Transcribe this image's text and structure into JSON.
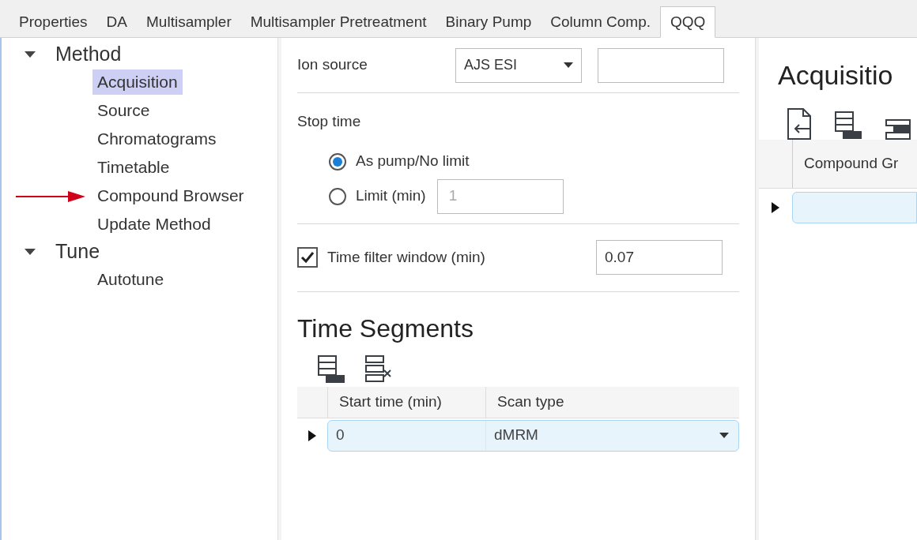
{
  "tabs": [
    {
      "label": "Properties",
      "selected": false
    },
    {
      "label": "DA",
      "selected": false
    },
    {
      "label": "Multisampler",
      "selected": false
    },
    {
      "label": "Multisampler Pretreatment",
      "selected": false
    },
    {
      "label": "Binary Pump",
      "selected": false
    },
    {
      "label": "Column Comp.",
      "selected": false
    },
    {
      "label": "QQQ",
      "selected": true
    }
  ],
  "tree": [
    {
      "label": "Method",
      "expanded": true,
      "children": [
        {
          "label": "Acquisition",
          "selected": true
        },
        {
          "label": "Source",
          "selected": false
        },
        {
          "label": "Chromatograms",
          "selected": false
        },
        {
          "label": "Timetable",
          "selected": false
        },
        {
          "label": "Compound Browser",
          "selected": false,
          "annotated": true
        },
        {
          "label": "Update Method",
          "selected": false
        }
      ]
    },
    {
      "label": "Tune",
      "expanded": true,
      "children": [
        {
          "label": "Autotune",
          "selected": false
        }
      ]
    }
  ],
  "ion_source": {
    "label": "Ion source",
    "value": "AJS ESI"
  },
  "stop_time": {
    "label": "Stop time",
    "options": [
      {
        "label": "As pump/No limit",
        "selected": true
      },
      {
        "label": "Limit (min)",
        "selected": false
      }
    ],
    "limit_value": "1",
    "limit_disabled": true
  },
  "time_filter": {
    "label": "Time filter window (min)",
    "checked": true,
    "value": "0.07"
  },
  "time_segments": {
    "title": "Time Segments",
    "columns": [
      "Start time (min)",
      "Scan type"
    ],
    "rows": [
      {
        "cells": [
          "0",
          "dMRM"
        ],
        "selected": true
      }
    ]
  },
  "acquisition": {
    "title": "Acquisitio",
    "columns": [
      "Compound Gr"
    ],
    "rows": [
      {
        "selected": true
      }
    ]
  }
}
